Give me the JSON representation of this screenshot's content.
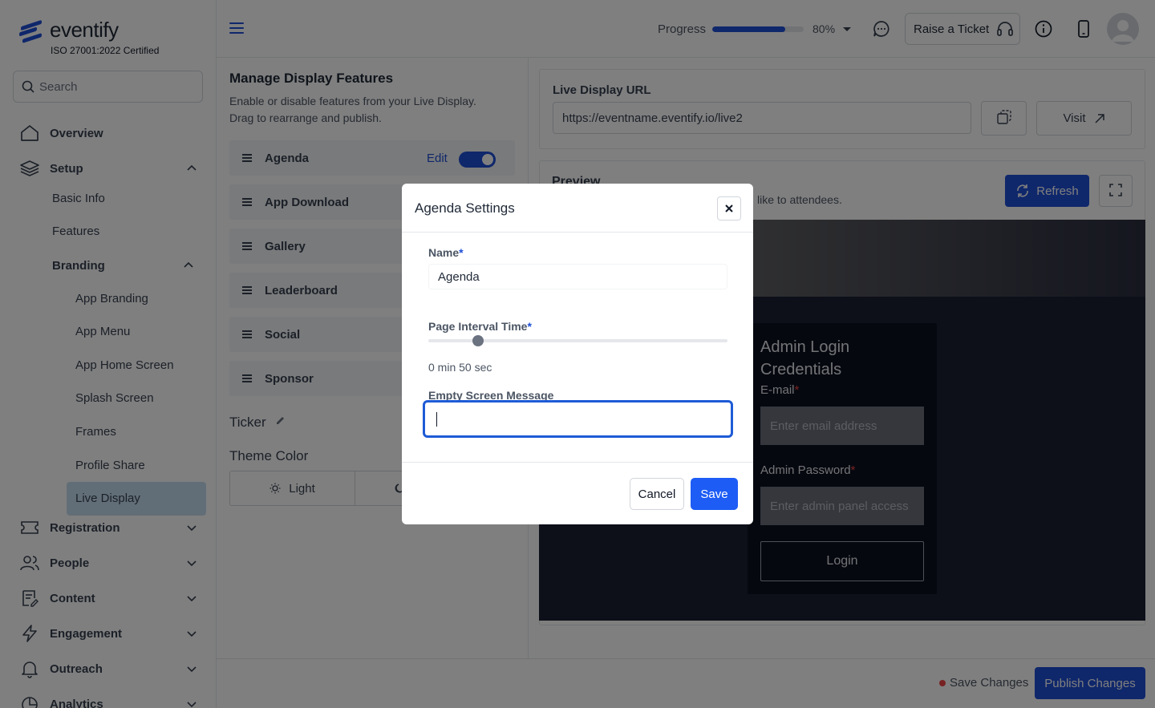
{
  "brand": {
    "name": "eventify",
    "certification": "ISO 27001:2022 Certified",
    "accent": "#1e4fd6"
  },
  "search": {
    "placeholder": "Search"
  },
  "sidebar": {
    "overview": "Overview",
    "setup": "Setup",
    "basic_info": "Basic Info",
    "features": "Features",
    "branding": "Branding",
    "branding_items": [
      "App Branding",
      "App Menu",
      "App Home Screen",
      "Splash Screen",
      "Frames",
      "Profile Share",
      "Live Display"
    ],
    "registration": "Registration",
    "people": "People",
    "content": "Content",
    "engagement": "Engagement",
    "outreach": "Outreach",
    "analytics": "Analytics"
  },
  "header": {
    "progress_label": "Progress",
    "progress_value": 80,
    "progress_text": "80%",
    "ticket_label": "Raise a Ticket"
  },
  "features_panel": {
    "title": "Manage Display Features",
    "description": "Enable or disable features from your Live Display. Drag to rearrange and publish.",
    "items": [
      "Agenda",
      "App Download",
      "Gallery",
      "Leaderboard",
      "Social",
      "Sponsor"
    ],
    "edit_label": "Edit",
    "ticker_label": "Ticker",
    "theme_title": "Theme Color",
    "theme_light": "Light"
  },
  "live_display": {
    "url_label": "Live Display URL",
    "url_value": "https://eventname.eventify.io/live2",
    "visit_label": "Visit",
    "preview_title": "Preview",
    "preview_desc": "like to attendees.",
    "refresh_label": "Refresh"
  },
  "login_preview": {
    "title": "Admin Login Credentials",
    "email_label": "E-mail",
    "email_placeholder": "Enter email address",
    "password_label": "Admin Password",
    "password_placeholder": "Enter admin panel access",
    "login_label": "Login",
    "required_mark": "*"
  },
  "footer": {
    "save_changes": "Save Changes",
    "publish": "Publish Changes"
  },
  "modal": {
    "title": "Agenda Settings",
    "name_label": "Name",
    "name_value": "Agenda",
    "interval_label": "Page Interval Time",
    "interval_fraction": 0.165,
    "interval_text": "0 min 50 sec",
    "message_label": "Empty Screen Message",
    "message_value": "",
    "required_mark": "*",
    "cancel_label": "Cancel",
    "save_label": "Save"
  }
}
